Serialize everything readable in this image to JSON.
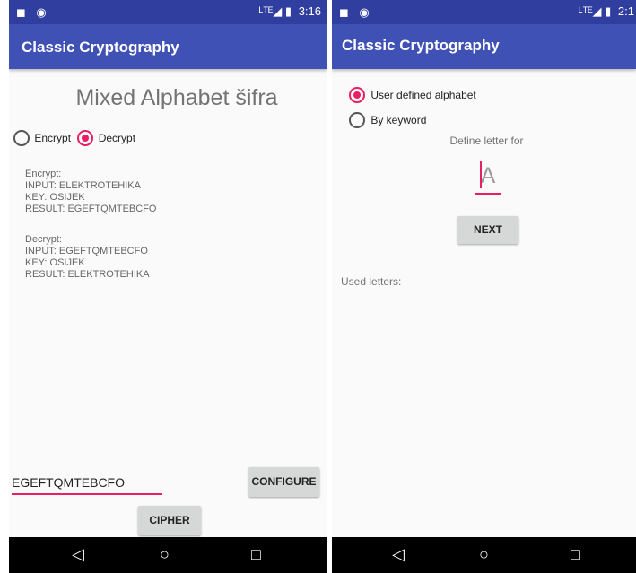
{
  "left": {
    "status": {
      "time": "3:16",
      "left_icons": "◼ ◉",
      "right_icons": "ᴸᵀᴱ◢ ▮"
    },
    "app_title": "Classic Cryptography",
    "heading": "Mixed Alphabet šifra",
    "radios": {
      "encrypt": "Encrypt",
      "decrypt": "Decrypt",
      "selected": "decrypt"
    },
    "info": {
      "encrypt_header": "Encrypt:",
      "encrypt_input": "INPUT: ELEKTROTEHIKA",
      "encrypt_key": "KEY: OSIJEK",
      "encrypt_result": "RESULT: EGEFTQMTEBCFO",
      "decrypt_header": "Decrypt:",
      "decrypt_input": "INPUT: EGEFTQMTEBCFO",
      "decrypt_key": "KEY: OSIJEK",
      "decrypt_result": "RESULT: ELEKTROTEHIKA"
    },
    "input_value": "EGEFTQMTEBCFO",
    "configure_label": "CONFIGURE",
    "cipher_label": "CIPHER"
  },
  "right": {
    "status": {
      "time": "2:1",
      "left_icons": "◼ ◉",
      "right_icons": "ᴸᵀᴱ◢ ▮"
    },
    "app_title": "Classic Cryptography",
    "radios": {
      "user_defined": "User defined alphabet",
      "by_keyword": "By keyword",
      "selected": "user_defined"
    },
    "define_label": "Define letter for",
    "letter_hint": "A",
    "next_label": "NEXT",
    "used_letters_label": "Used letters:"
  },
  "nav": {
    "back": "◁",
    "home": "○",
    "recents": "□"
  },
  "colors": {
    "status_bar": "#303f9f",
    "app_bar": "#3f51b5",
    "accent": "#e91e63"
  }
}
